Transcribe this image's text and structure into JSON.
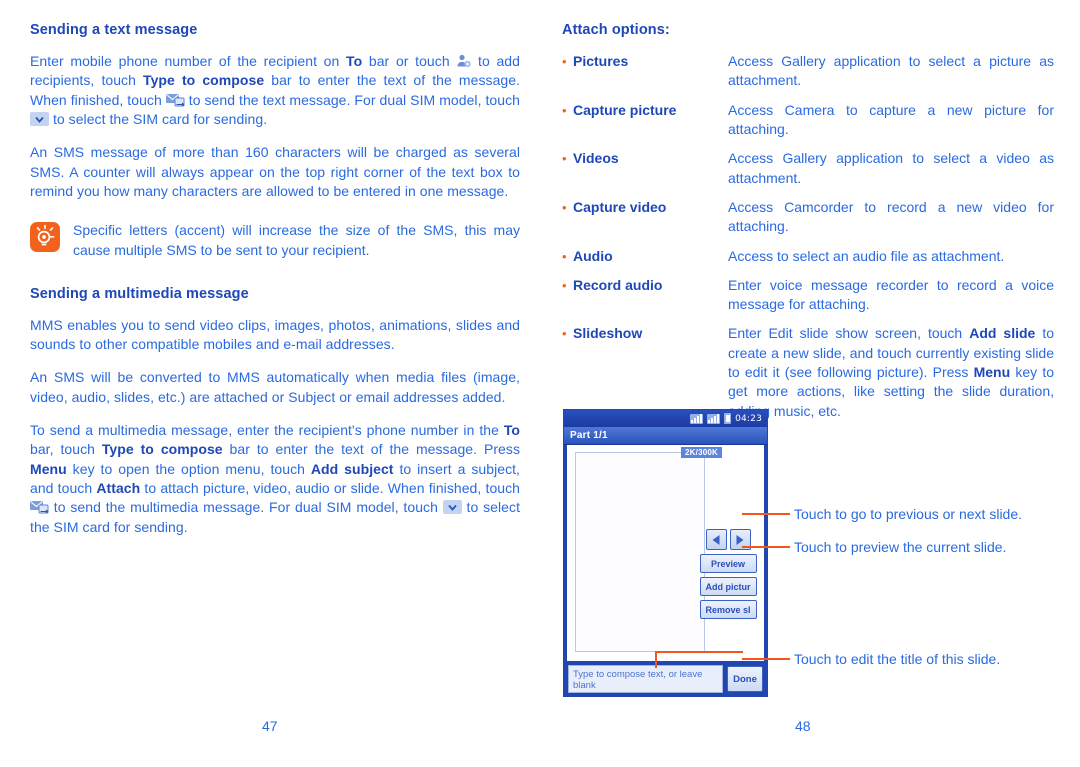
{
  "colors": {
    "heading_blue": "#1e48b8",
    "body_blue": "#2a6ae0",
    "accent_orange": "#f3621c",
    "leader_orange": "#f0561d",
    "phone_chrome_blue": "#2246b0"
  },
  "left_column": {
    "heading_1": "Sending a text message",
    "para_1": {
      "s1": "Enter mobile phone number of the recipient on ",
      "b1": "To",
      "s2": " bar or touch ",
      "icon1": "add-contact-icon",
      "s3": " to add recipients, touch ",
      "b2": "Type to compose",
      "s4": " bar to enter the text of the message. When finished, touch ",
      "icon2": "send-message-icon",
      "s5": " to send the text message. For dual SIM model, touch ",
      "icon3": "chevron-down-icon",
      "s6": " to select the SIM card for sending."
    },
    "para_2": "An SMS message of more than 160 characters will be charged as several SMS. A counter will always appear on the top right corner of the text box to remind you how many characters are allowed to be entered in one message.",
    "tip": {
      "icon": "lightbulb-tip-icon",
      "text": "Specific letters (accent) will increase the size of the SMS, this may cause multiple SMS to be sent to your recipient."
    },
    "heading_2": "Sending a multimedia message",
    "para_3": "MMS enables you to send video clips, images, photos, animations, slides and sounds to other compatible mobiles and e-mail addresses.",
    "para_4": "An SMS will be converted to MMS automatically when media files (image, video, audio, slides, etc.) are attached or Subject or email addresses added.",
    "para_5": {
      "s1": "To send a multimedia message, enter the recipient's phone number in the ",
      "b1": "To",
      "s2": " bar, touch ",
      "b2": "Type to compose",
      "s3": " bar to enter the text of the message. Press ",
      "b3": "Menu",
      "s4": " key to open the option menu, touch ",
      "b4": "Add subject",
      "s5": " to insert a subject, and touch ",
      "b5": "Attach",
      "s6": " to attach picture, video, audio or slide. When finished, touch ",
      "icon1": "send-message-icon",
      "s7": " to send the multimedia message. For dual SIM model, touch ",
      "icon2": "chevron-down-icon",
      "s8": " to select the SIM card for sending."
    },
    "page_number": "47"
  },
  "right_column": {
    "heading": "Attach options:",
    "options": [
      {
        "bullet": "•",
        "term": "Pictures",
        "desc": "Access Gallery application to select a picture as attachment."
      },
      {
        "bullet": "•",
        "term": "Capture picture",
        "desc": "Access Camera to capture a new picture for attaching."
      },
      {
        "bullet": "•",
        "term": "Videos",
        "desc": "Access Gallery application to select a video as attachment."
      },
      {
        "bullet": "•",
        "term": "Capture video",
        "desc": "Access Camcorder to record a new video for attaching."
      },
      {
        "bullet": "•",
        "term": "Audio",
        "desc": "Access to select an audio file as attachment."
      },
      {
        "bullet": "•",
        "term": "Record audio",
        "desc": "Enter voice message recorder to record a voice message for attaching."
      }
    ],
    "slideshow": {
      "bullet": "•",
      "term": "Slideshow",
      "s1": "Enter Edit slide show screen, touch ",
      "b1": "Add slide",
      "s2": " to create a new slide, and touch currently existing slide to edit it (see following picture). Press ",
      "b2": "Menu",
      "s3": " key to get more actions, like setting the slide duration, adding music, etc."
    },
    "page_number": "48"
  },
  "phone_mock": {
    "status_bar": {
      "signal_icon_1": "signal-bars-icon",
      "signal_icon_2": "signal-bars-icon",
      "battery_icon": "battery-icon",
      "time": "04:23"
    },
    "title_bar": "Part 1/1",
    "size_badge": "2K/300K",
    "controls": {
      "prev_icon": "arrow-left-icon",
      "next_icon": "arrow-right-icon",
      "preview": "Preview",
      "add_picture": "Add pictur",
      "remove_slide": "Remove sl"
    },
    "compose_placeholder": "Type to compose text, or leave blank",
    "done_button": "Done"
  },
  "callouts": [
    {
      "text": "Touch to go to previous or next slide."
    },
    {
      "text": "Touch to preview the current slide."
    },
    {
      "text": "Touch to edit the title of this slide."
    }
  ]
}
